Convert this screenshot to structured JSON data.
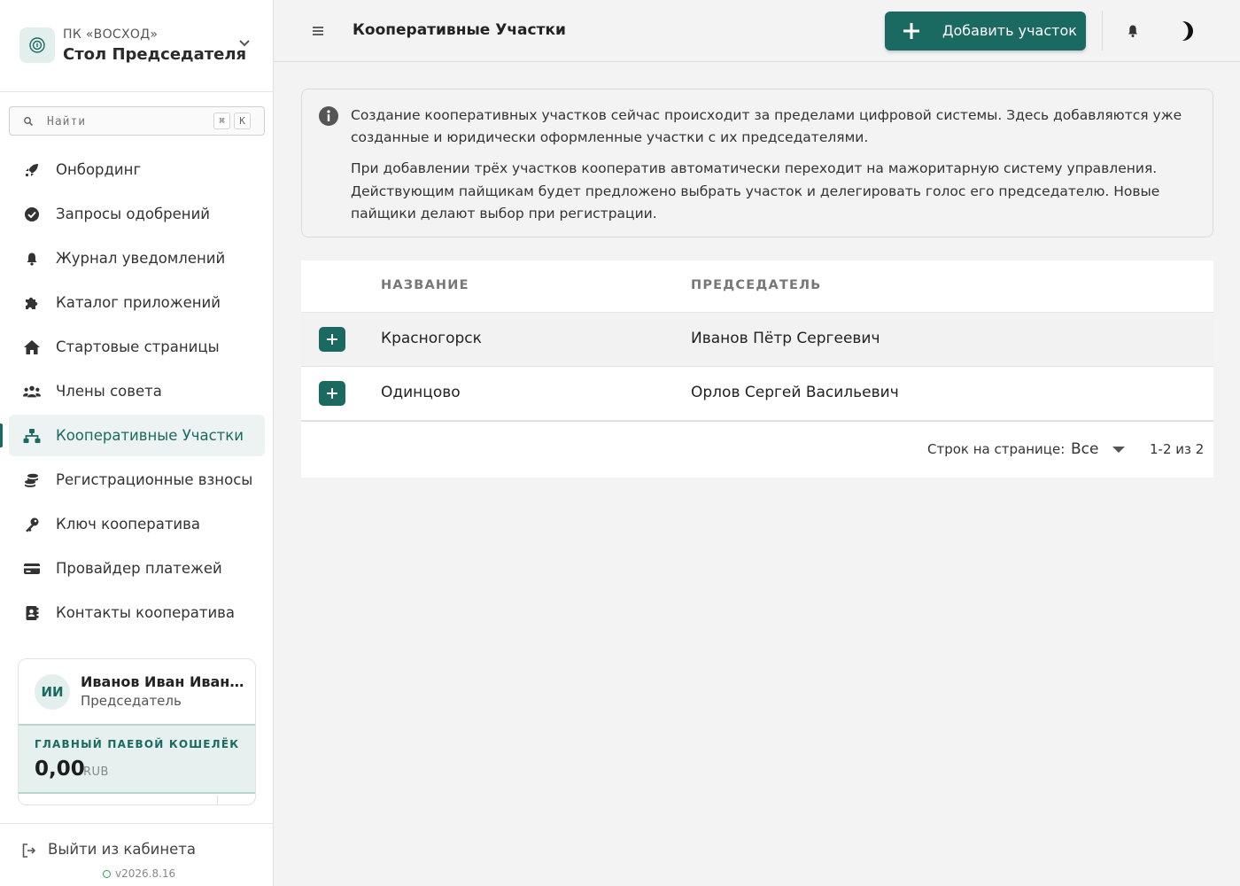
{
  "brand": {
    "org": "ПК «ВОСХОД»",
    "title": "Стол Председателя"
  },
  "search": {
    "placeholder": "Найти",
    "shortcut_mod": "⌘",
    "shortcut_key": "K"
  },
  "sidebar": {
    "items": [
      {
        "label": "Онбординг",
        "icon": "rocket-icon"
      },
      {
        "label": "Запросы одобрений",
        "icon": "check-circle-icon"
      },
      {
        "label": "Журнал уведомлений",
        "icon": "bell-icon"
      },
      {
        "label": "Каталог приложений",
        "icon": "puzzle-icon"
      },
      {
        "label": "Стартовые страницы",
        "icon": "home-icon"
      },
      {
        "label": "Члены совета",
        "icon": "people-icon"
      },
      {
        "label": "Кооперативные Участки",
        "icon": "sitemap-icon",
        "active": true
      },
      {
        "label": "Регистрационные взносы",
        "icon": "coins-icon"
      },
      {
        "label": "Ключ кооператива",
        "icon": "key-icon"
      },
      {
        "label": "Провайдер платежей",
        "icon": "credit-card-icon"
      },
      {
        "label": "Контакты кооператива",
        "icon": "contact-book-icon"
      }
    ]
  },
  "user": {
    "initials": "ИИ",
    "name": "Иванов Иван Иванович",
    "role": "Председатель",
    "wallet_label": "ГЛАВНЫЙ ПАЕВОЙ КОШЕЛЁК",
    "wallet_amount": "0,00",
    "wallet_currency": "RUB"
  },
  "logout": {
    "label": "Выйти из кабинета"
  },
  "version": "v2026.8.16",
  "header": {
    "title": "Кооперативные Участки",
    "add_button": "Добавить участок"
  },
  "info": {
    "p1": "Создание кооперативных участков сейчас происходит за пределами цифровой системы. Здесь добавляются уже созданные и юридически оформленные участки с их председателями.",
    "p2": "При добавлении трёх участков кооператив автоматически переходит на мажоритарную систему управления. Действующим пайщикам будет предложено выбрать участок и делегировать голос его председателю. Новые пайщики делают выбор при регистрации."
  },
  "table": {
    "columns": [
      "НАЗВАНИЕ",
      "ПРЕДСЕДАТЕЛЬ"
    ],
    "rows": [
      {
        "name": "Красногорск",
        "chairman": "Иванов Пётр Сергеевич"
      },
      {
        "name": "Одинцово",
        "chairman": "Орлов Сергей Васильевич"
      }
    ],
    "rows_per_page_label": "Строк на странице:",
    "rows_per_page_value": "Все",
    "pagination": "1-2 из 2"
  },
  "colors": {
    "accent": "#1b6a62",
    "active_bg": "#ecf3f2",
    "wallet_bg": "#e6f1ef"
  }
}
